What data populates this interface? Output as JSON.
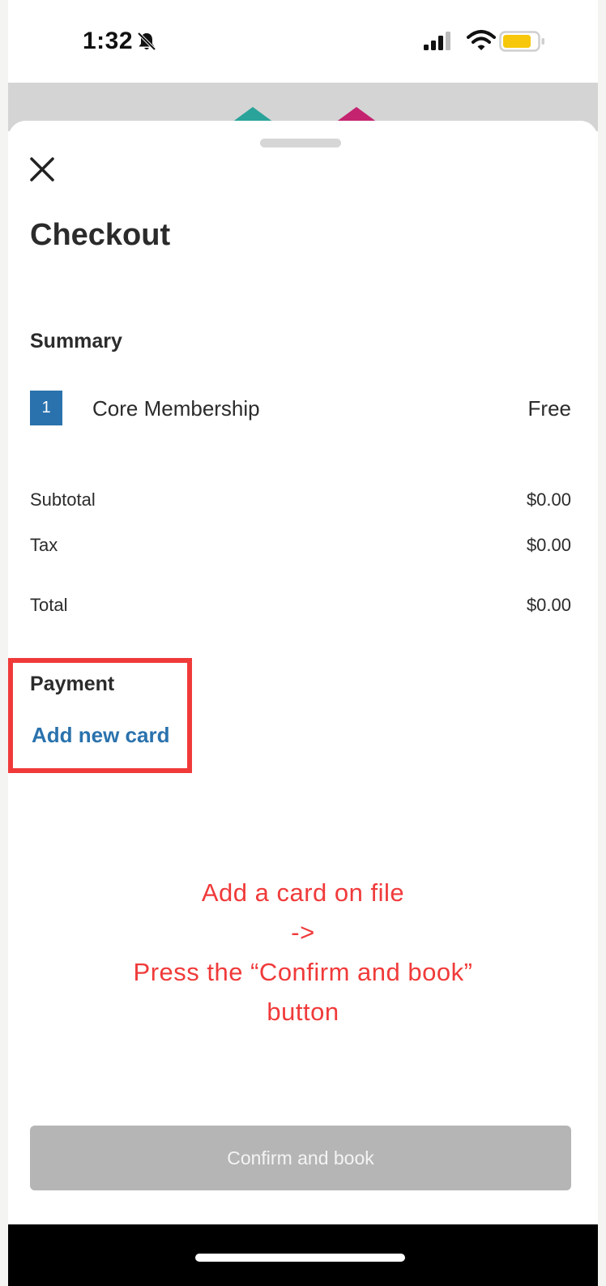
{
  "status_bar": {
    "time": "1:32"
  },
  "sheet": {
    "title": "Checkout",
    "summary": {
      "label": "Summary",
      "items": [
        {
          "quantity": "1",
          "name": "Core Membership",
          "price": "Free"
        }
      ],
      "subtotal_label": "Subtotal",
      "subtotal_value": "$0.00",
      "tax_label": "Tax",
      "tax_value": "$0.00",
      "total_label": "Total",
      "total_value": "$0.00"
    },
    "payment": {
      "label": "Payment",
      "add_card": "Add new card"
    },
    "confirm_button": "Confirm and book"
  },
  "annotation": {
    "line1": "Add a card on file",
    "line2": "->",
    "line3": "Press the “Confirm and book”",
    "line4": "button",
    "color": "#f03a3a"
  },
  "colors": {
    "accent": "#2a72ad",
    "button_disabled": "#b5b5b5",
    "backdrop_teal": "#2aa39a",
    "backdrop_pink": "#c4236f"
  },
  "icons": {
    "close": "close-icon",
    "bell": "bell-slash-icon",
    "signal": "cellular-signal-icon",
    "wifi": "wifi-icon",
    "battery": "battery-icon"
  }
}
